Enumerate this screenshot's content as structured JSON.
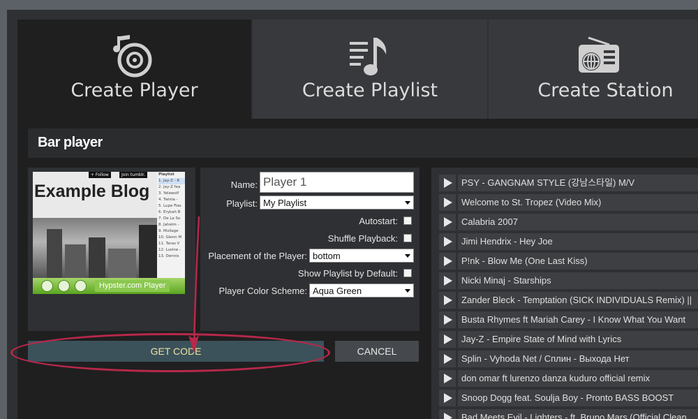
{
  "tabs": [
    {
      "label": "Create Player",
      "icon": "speaker-note-icon"
    },
    {
      "label": "Create Playlist",
      "icon": "playlist-note-icon"
    },
    {
      "label": "Create Station",
      "icon": "radio-globe-icon"
    }
  ],
  "section_title": "Bar player",
  "preview": {
    "blog_title": "Example Blog",
    "follow": "+ Follow",
    "join": "Join tumblr.",
    "playlist_header": "Playlist",
    "playlist_items": [
      "1. Jay-Z - R",
      "2. Jay-Z fea",
      "3. Yelawolf",
      "4. Twista -",
      "5. Lupe Fias",
      "6. Erykah B",
      "7. De La So",
      "8. Jaheim -",
      "9. Mullage",
      "10. Glenn M",
      "11. Taras V",
      "12. Lusine -",
      "13. Dennis"
    ],
    "brand": "Hypster.com Player"
  },
  "form": {
    "name_label": "Name:",
    "name_value": "Player 1",
    "playlist_label": "Playlist:",
    "playlist_value": "My Playlist",
    "autostart_label": "Autostart:",
    "shuffle_label": "Shuffle Playback:",
    "placement_label": "Placement of the Player:",
    "placement_value": "bottom",
    "show_playlist_label": "Show Playlist by Default:",
    "color_label": "Player Color Scheme:",
    "color_value": "Aqua Green"
  },
  "buttons": {
    "get_code": "GET CODE",
    "cancel": "CANCEL"
  },
  "songs": [
    "PSY - GANGNAM STYLE (강남스타일) M/V",
    "Welcome to St. Tropez (Video Mix)",
    "Calabria 2007",
    "Jimi Hendrix - Hey Joe",
    "P!nk - Blow Me (One Last Kiss)",
    "Nicki Minaj - Starships",
    "Zander Bleck - Temptation (SICK INDIVIDUALS Remix) ||",
    "Busta Rhymes ft Mariah Carey - I Know What You Want",
    "Jay-Z - Empire State of Mind with Lyrics",
    "Splin - Vyhoda Net / Сплин - Выхода Нет",
    "don omar ft lurenzo danza kuduro official remix",
    "Snoop Dogg feat. Soulja Boy - Pronto BASS BOOST",
    "Bad Meets Evil - Lighters - ft. Bruno Mars (Official Clean"
  ],
  "colors": {
    "accent_ellipse": "#b8284a",
    "get_code_bg": "#3b525b",
    "get_code_text": "#f0e2a0"
  }
}
